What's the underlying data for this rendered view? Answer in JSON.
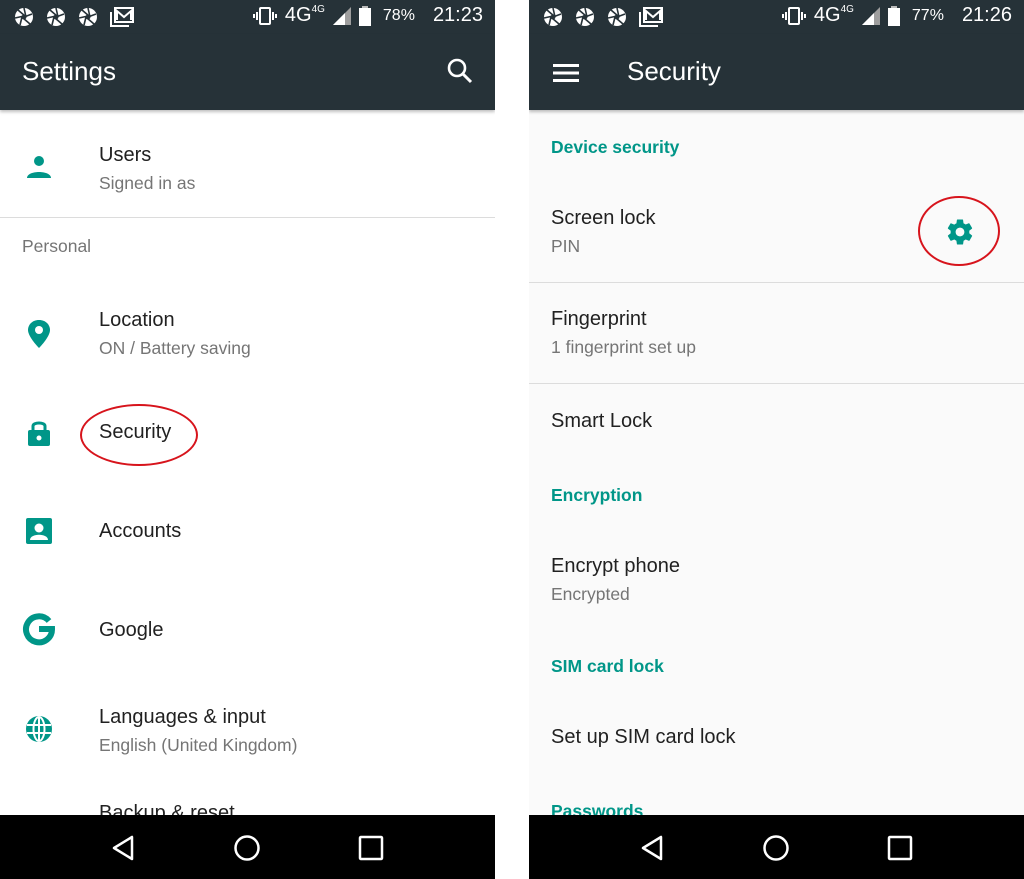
{
  "left_screen": {
    "status_bar": {
      "notification_icons": [
        "aperture-icon",
        "aperture-icon",
        "aperture-icon",
        "gmail-icon"
      ],
      "vibrate_icon": "vibrate-icon",
      "network_label": "4G",
      "network_superscript": "4G",
      "battery_percent": "78%",
      "time": "21:23"
    },
    "app_bar": {
      "title": "Settings",
      "action_icon": "search-icon"
    },
    "items": [
      {
        "icon": "person-icon",
        "title": "Users",
        "subtitle": "Signed in as"
      },
      {
        "section": "Personal"
      },
      {
        "icon": "location-pin-icon",
        "title": "Location",
        "subtitle": "ON / Battery saving"
      },
      {
        "icon": "lock-icon",
        "title": "Security",
        "annotated": true
      },
      {
        "icon": "account-box-icon",
        "title": "Accounts"
      },
      {
        "icon": "google-icon",
        "title": "Google"
      },
      {
        "icon": "globe-icon",
        "title": "Languages & input",
        "subtitle": "English (United Kingdom)"
      },
      {
        "title": "Backup & reset",
        "partially_visible": true
      }
    ]
  },
  "right_screen": {
    "status_bar": {
      "notification_icons": [
        "aperture-icon",
        "aperture-icon",
        "aperture-icon",
        "gmail-icon"
      ],
      "vibrate_icon": "vibrate-icon",
      "network_label": "4G",
      "network_superscript": "4G",
      "battery_percent": "77%",
      "time": "21:26"
    },
    "app_bar": {
      "title": "Security",
      "nav_icon": "menu-icon"
    },
    "sections": {
      "device_security": "Device security",
      "encryption": "Encryption",
      "sim_card_lock": "SIM card lock",
      "passwords": "Passwords"
    },
    "items": {
      "screen_lock": {
        "title": "Screen lock",
        "subtitle": "PIN",
        "action_icon": "gear-icon",
        "annotated": true
      },
      "fingerprint": {
        "title": "Fingerprint",
        "subtitle": "1 fingerprint set up"
      },
      "smart_lock": {
        "title": "Smart Lock"
      },
      "encrypt_phone": {
        "title": "Encrypt phone",
        "subtitle": "Encrypted"
      },
      "sim_lock": {
        "title": "Set up SIM card lock"
      }
    }
  },
  "nav_bar": {
    "buttons": [
      "back-icon",
      "home-icon",
      "recents-icon"
    ]
  },
  "colors": {
    "toolbar": "#263238",
    "accent": "#009688",
    "annotation": "#d7141c"
  }
}
